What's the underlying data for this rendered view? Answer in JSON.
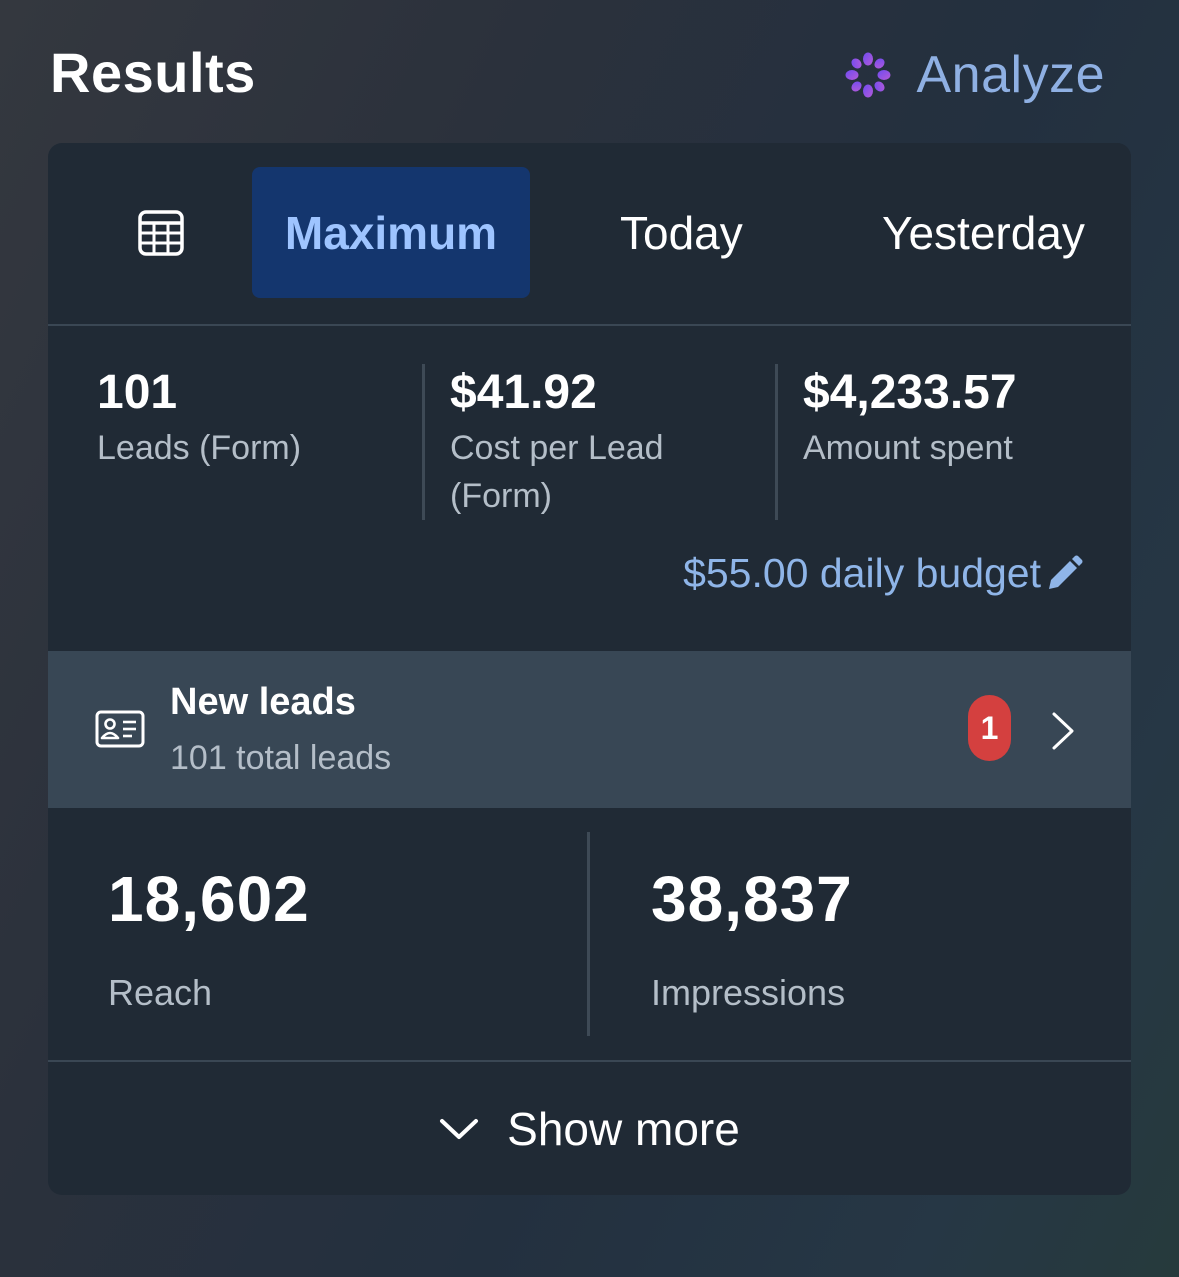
{
  "header": {
    "title": "Results",
    "analyze_label": "Analyze",
    "analyze_icon": "sparkle-icon",
    "accent_color": "#8fb0e3"
  },
  "tabs": {
    "icon": "calendar-table-icon",
    "items": [
      {
        "label": "Maximum",
        "active": true
      },
      {
        "label": "Today",
        "active": false
      },
      {
        "label": "Yesterday",
        "active": false
      }
    ],
    "active_bg": "#14366e",
    "active_color": "#9ec4ff"
  },
  "metrics": [
    {
      "value": "101",
      "label": "Leads (Form)"
    },
    {
      "value": "$41.92",
      "label": "Cost per Lead (Form)"
    },
    {
      "value": "$4,233.57",
      "label": "Amount spent"
    }
  ],
  "budget": {
    "label": "$55.00 daily budget",
    "icon": "pencil-icon"
  },
  "leads": {
    "icon": "contact-card-icon",
    "title": "New leads",
    "subtitle": "101 total leads",
    "badge": "1",
    "badge_color": "#d4403f",
    "chevron": "chevron-right-icon"
  },
  "stats": [
    {
      "value": "18,602",
      "label": "Reach"
    },
    {
      "value": "38,837",
      "label": "Impressions"
    }
  ],
  "show_more": {
    "label": "Show more",
    "icon": "chevron-down-icon"
  }
}
